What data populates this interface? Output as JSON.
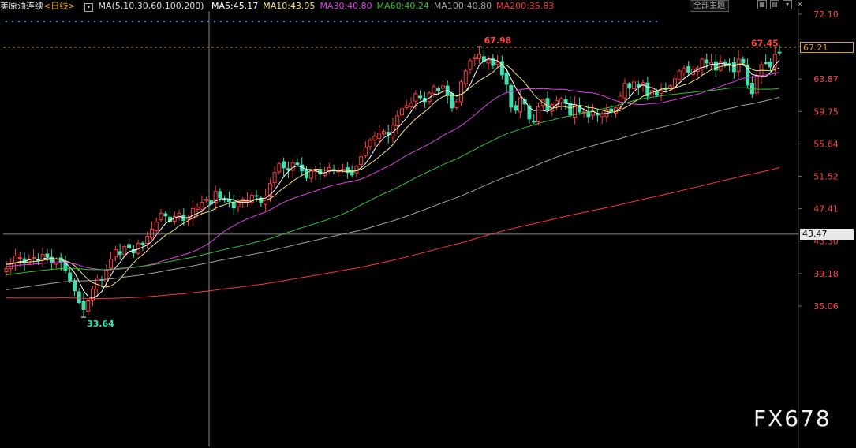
{
  "header": {
    "title": "美原油连续",
    "period": "<日线>",
    "ma_params": "MA(5,10,30,60,100,200)",
    "ma_labels": [
      {
        "text": "MA5:45.17",
        "color": "#ffffff"
      },
      {
        "text": "MA10:43.95",
        "color": "#f5e47a"
      },
      {
        "text": "MA30:40.80",
        "color": "#e040e8"
      },
      {
        "text": "MA60:40.24",
        "color": "#30c030"
      },
      {
        "text": "MA100:40.80",
        "color": "#a0a0a0"
      },
      {
        "text": "MA200:35.83",
        "color": "#ff3333"
      }
    ],
    "theme_button": "全部主题",
    "tool_icons": [
      "grid-icon",
      "layout-icon",
      "dropdown-icon",
      "close-icon"
    ]
  },
  "watermark": "FX678",
  "colors": {
    "up": "#ff3b3b",
    "down": "#3fe0b0",
    "axis_text": "#ff4040",
    "crosshair": "#888888",
    "highlight": "#e0a020"
  },
  "chart_data": {
    "type": "candlestick",
    "y_ticks": [
      "72.10",
      "67.99",
      "63.87",
      "59.75",
      "55.64",
      "51.52",
      "47.41",
      "43.30",
      "39.18",
      "35.06"
    ],
    "ylim": [
      33.0,
      72.1
    ],
    "grid": false,
    "current_price": "67.21",
    "crosshair_price": "43.47",
    "annotations": [
      {
        "text": "67.98",
        "value": 67.98,
        "kind": "high"
      },
      {
        "text": "67.45",
        "value": 67.45,
        "kind": "last-high"
      },
      {
        "text": "33.64",
        "value": 33.64,
        "kind": "low"
      }
    ],
    "closes": [
      39.8,
      40.5,
      41.4,
      41.2,
      40.5,
      41.0,
      41.2,
      40.8,
      41.6,
      41.3,
      40.5,
      41.0,
      40.6,
      39.5,
      38.3,
      37.0,
      35.5,
      34.6,
      35.8,
      37.2,
      38.6,
      38.4,
      39.6,
      41.0,
      42.2,
      41.6,
      42.6,
      42.4,
      41.8,
      43.0,
      42.9,
      43.9,
      44.8,
      45.7,
      46.8,
      46.5,
      45.8,
      46.4,
      46.8,
      45.9,
      46.3,
      47.4,
      47.6,
      48.2,
      48.6,
      48.0,
      49.6,
      48.8,
      48.5,
      48.3,
      47.5,
      48.2,
      48.6,
      48.4,
      49.1,
      49.0,
      48.2,
      49.0,
      50.6,
      52.0,
      53.1,
      52.6,
      52.3,
      53.2,
      53.0,
      52.2,
      51.3,
      52.2,
      52.4,
      51.8,
      52.0,
      52.6,
      52.3,
      52.2,
      52.4,
      52.0,
      51.7,
      52.8,
      54.0,
      55.2,
      56.1,
      56.6,
      57.0,
      57.2,
      56.8,
      58.0,
      59.2,
      60.1,
      60.5,
      60.8,
      62.0,
      61.5,
      61.0,
      62.1,
      62.9,
      62.4,
      63.0,
      61.8,
      60.2,
      61.0,
      63.5,
      64.9,
      66.2,
      66.6,
      67.0,
      66.1,
      66.3,
      65.6,
      66.0,
      64.4,
      63.2,
      60.3,
      59.9,
      61.5,
      60.7,
      58.8,
      58.4,
      60.3,
      61.2,
      60.0,
      60.6,
      61.1,
      61.4,
      60.8,
      59.3,
      60.6,
      59.7,
      59.7,
      59.1,
      59.7,
      59.3,
      59.4,
      60.0,
      59.8,
      60.2,
      61.7,
      63.3,
      62.7,
      63.5,
      62.9,
      63.4,
      61.7,
      62.4,
      61.8,
      62.5,
      62.6,
      63.0,
      63.9,
      64.9,
      65.2,
      64.7,
      65.1,
      65.3,
      66.4,
      65.9,
      66.0,
      65.0,
      66.1,
      65.8,
      65.7,
      64.8,
      66.4,
      65.9,
      63.1,
      62.0,
      64.3,
      65.7,
      65.9,
      65.4,
      67.0,
      67.21
    ],
    "ma_series": [
      {
        "name": "MA5",
        "period": 5,
        "color": "#ffffff"
      },
      {
        "name": "MA10",
        "period": 10,
        "color": "#f5e47a"
      },
      {
        "name": "MA30",
        "period": 30,
        "color": "#e040e8"
      },
      {
        "name": "MA60",
        "period": 60,
        "color": "#30c030"
      },
      {
        "name": "MA100",
        "period": 100,
        "color": "#a0a0a0"
      },
      {
        "name": "MA200",
        "period": 200,
        "color": "#ff3333"
      }
    ]
  }
}
